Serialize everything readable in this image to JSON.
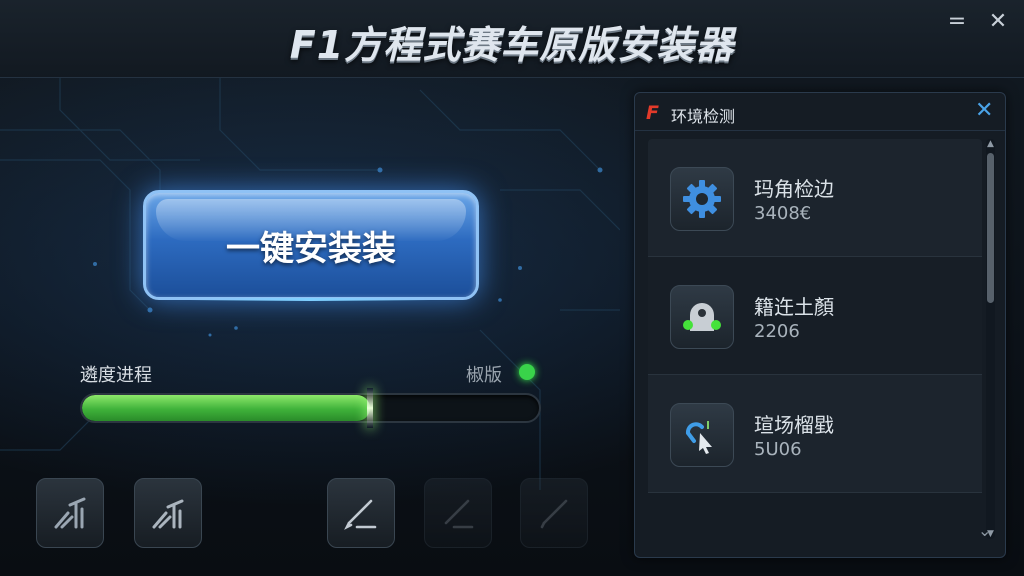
{
  "window": {
    "title": "F1方程式赛车原版安装器",
    "minimize_glyph": "=",
    "close_glyph": "✕"
  },
  "main": {
    "install_button_label": "一键安装装",
    "progress_label": "遴度进程",
    "status_label": "椒版",
    "status_color": "#39d34a",
    "progress_fraction": 0.63,
    "tools": [
      {
        "icon": "mechanic-tool-icon",
        "dim": false
      },
      {
        "icon": "mechanic-tool-icon",
        "dim": false
      },
      {
        "icon": "pen-tool-icon",
        "dim": false
      },
      {
        "icon": "pen-tool-icon",
        "dim": true
      },
      {
        "icon": "pen-tool-icon",
        "dim": true
      }
    ]
  },
  "panel": {
    "logo": "F",
    "title": "环境检测",
    "close_glyph": "✕",
    "items": [
      {
        "name": "玛角检边",
        "value": "3408€",
        "icon": "gear-icon"
      },
      {
        "name": "籍迕土顏",
        "value": "2206",
        "icon": "helmet-icon"
      },
      {
        "name": "瑄场榴戥",
        "value": "5U06",
        "icon": "cursor-link-icon"
      }
    ]
  },
  "colors": {
    "accent_blue": "#2d6bc0",
    "progress_green": "#3fb23a",
    "brand_red": "#e23a2a"
  }
}
